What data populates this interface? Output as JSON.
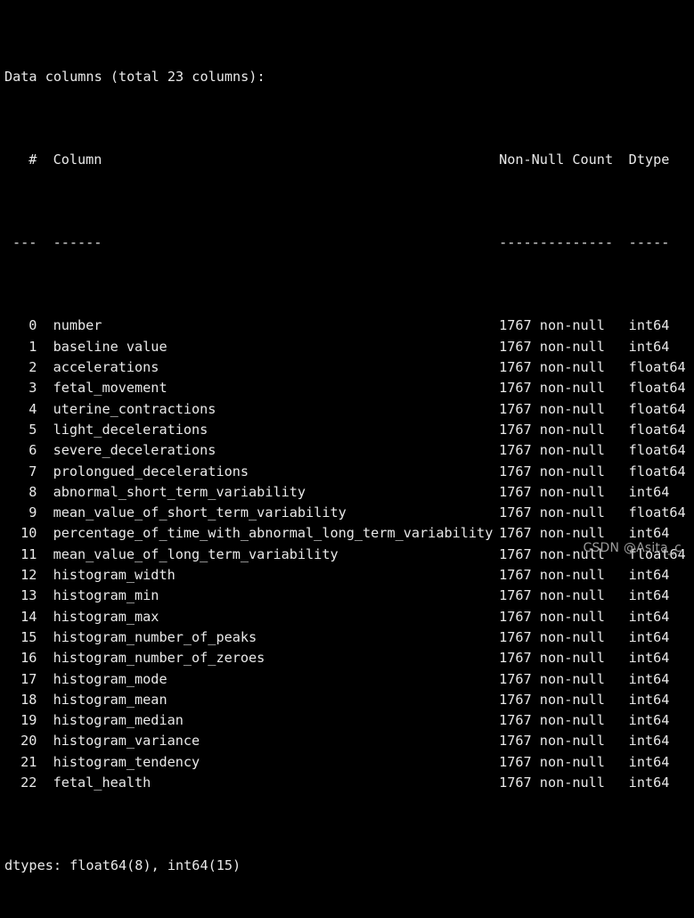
{
  "terminal": {
    "background_color": "#000000",
    "text_color": "#e9e9e9",
    "title_line": "Data columns (total 23 columns):",
    "footer_line": "dtypes: float64(8), int64(15)"
  },
  "table": {
    "headers": {
      "index": "#",
      "column": "Column",
      "non_null_count": "Non-Null Count",
      "dtype": "Dtype"
    },
    "separators": {
      "index": "---",
      "column": "------",
      "non_null_count": "--------------",
      "dtype": "-----"
    },
    "rows": [
      {
        "index": "0",
        "column": "number",
        "non_null_count": "1767 non-null",
        "dtype": "int64"
      },
      {
        "index": "1",
        "column": "baseline value",
        "non_null_count": "1767 non-null",
        "dtype": "int64"
      },
      {
        "index": "2",
        "column": "accelerations",
        "non_null_count": "1767 non-null",
        "dtype": "float64"
      },
      {
        "index": "3",
        "column": "fetal_movement",
        "non_null_count": "1767 non-null",
        "dtype": "float64"
      },
      {
        "index": "4",
        "column": "uterine_contractions",
        "non_null_count": "1767 non-null",
        "dtype": "float64"
      },
      {
        "index": "5",
        "column": "light_decelerations",
        "non_null_count": "1767 non-null",
        "dtype": "float64"
      },
      {
        "index": "6",
        "column": "severe_decelerations",
        "non_null_count": "1767 non-null",
        "dtype": "float64"
      },
      {
        "index": "7",
        "column": "prolongued_decelerations",
        "non_null_count": "1767 non-null",
        "dtype": "float64"
      },
      {
        "index": "8",
        "column": "abnormal_short_term_variability",
        "non_null_count": "1767 non-null",
        "dtype": "int64"
      },
      {
        "index": "9",
        "column": "mean_value_of_short_term_variability",
        "non_null_count": "1767 non-null",
        "dtype": "float64"
      },
      {
        "index": "10",
        "column": "percentage_of_time_with_abnormal_long_term_variability",
        "non_null_count": "1767 non-null",
        "dtype": "int64"
      },
      {
        "index": "11",
        "column": "mean_value_of_long_term_variability",
        "non_null_count": "1767 non-null",
        "dtype": "float64"
      },
      {
        "index": "12",
        "column": "histogram_width",
        "non_null_count": "1767 non-null",
        "dtype": "int64"
      },
      {
        "index": "13",
        "column": "histogram_min",
        "non_null_count": "1767 non-null",
        "dtype": "int64"
      },
      {
        "index": "14",
        "column": "histogram_max",
        "non_null_count": "1767 non-null",
        "dtype": "int64"
      },
      {
        "index": "15",
        "column": "histogram_number_of_peaks",
        "non_null_count": "1767 non-null",
        "dtype": "int64"
      },
      {
        "index": "16",
        "column": "histogram_number_of_zeroes",
        "non_null_count": "1767 non-null",
        "dtype": "int64"
      },
      {
        "index": "17",
        "column": "histogram_mode",
        "non_null_count": "1767 non-null",
        "dtype": "int64"
      },
      {
        "index": "18",
        "column": "histogram_mean",
        "non_null_count": "1767 non-null",
        "dtype": "int64"
      },
      {
        "index": "19",
        "column": "histogram_median",
        "non_null_count": "1767 non-null",
        "dtype": "int64"
      },
      {
        "index": "20",
        "column": "histogram_variance",
        "non_null_count": "1767 non-null",
        "dtype": "int64"
      },
      {
        "index": "21",
        "column": "histogram_tendency",
        "non_null_count": "1767 non-null",
        "dtype": "int64"
      },
      {
        "index": "22",
        "column": "fetal_health",
        "non_null_count": "1767 non-null",
        "dtype": "int64"
      }
    ]
  },
  "watermark": {
    "text": "CSDN @Asita_c",
    "color": "#9a9a9a"
  }
}
